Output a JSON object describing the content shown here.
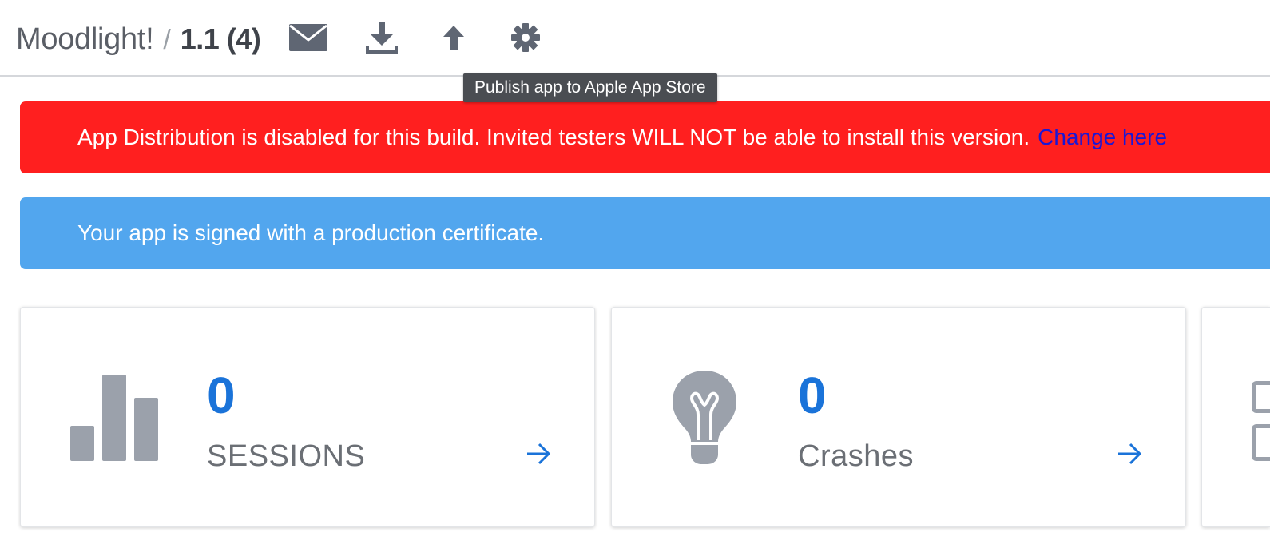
{
  "header": {
    "app_name": "Moodlight!",
    "separator": "/",
    "version": "1.1 (4)",
    "icons": [
      "mail-icon",
      "download-icon",
      "upload-icon",
      "gear-icon"
    ]
  },
  "tooltip": {
    "text": "Publish app to Apple App Store"
  },
  "banners": {
    "distribution": {
      "text": "App Distribution is disabled for this build. Invited testers WILL NOT be able to install this version.",
      "link": "Change here",
      "color": "#ff1f1f"
    },
    "certificate": {
      "text": "Your app is signed with a production certificate.",
      "color": "#52a6ee"
    }
  },
  "cards": [
    {
      "icon": "bar-chart-icon",
      "value": "0",
      "label": "SESSIONS"
    },
    {
      "icon": "lightbulb-icon",
      "value": "0",
      "label": "Crashes"
    }
  ],
  "colors": {
    "accent": "#1a73d9",
    "icon_gray": "#5f6673",
    "card_icon_gray": "#9ba1ab"
  }
}
